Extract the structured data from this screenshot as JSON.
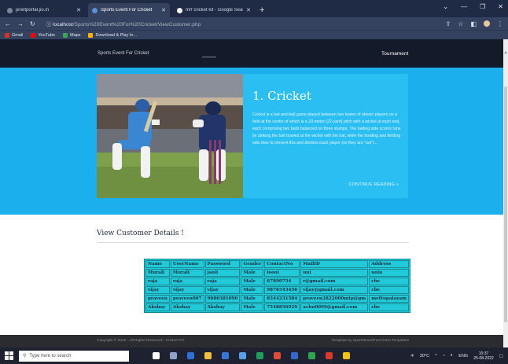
{
  "browser": {
    "tabs": [
      {
        "title": "jenetportal.jio.in",
        "color": "#7a869f",
        "active": false
      },
      {
        "title": "Sports Event For Cricket",
        "color": "#5b8fd9",
        "active": true
      },
      {
        "title": "mrf cricket kit - Google Search",
        "color": "#ffffff",
        "active": false
      }
    ],
    "url_host": "localhost",
    "url_path": "/Sports%20Event%20For%20Cricket/ViewCustomer.php",
    "bookmarks": [
      {
        "label": "Gmail",
        "color": "#d93025"
      },
      {
        "label": "YouTube",
        "color": "#ff0000"
      },
      {
        "label": "Maps",
        "color": "#34a853"
      },
      {
        "label": "Download & Play In...",
        "color": "#f4b400"
      }
    ]
  },
  "site": {
    "brand": "Sports Event For Cricket",
    "nav_tournament": "Tournament"
  },
  "hero": {
    "title": "1. Cricket",
    "body": "Cricket is a bat-and-ball game played between two teams of eleven players on a field at the centre of which is a 20-metre (22-yard) pitch with a wicket at each end, each comprising two bails balanced on three stumps. The batting side scores runs by striking the ball bowled at the wicket with the bat, while the bowling and fielding side tries to prevent this and dismiss each player (so they are \"out\")...",
    "more": "CONTINUE READING »"
  },
  "customers": {
    "heading": "View Customer Details !",
    "columns": [
      "Name",
      "UserName",
      "Password",
      "Gender",
      "ContactNo",
      "MailID",
      "Address"
    ],
    "rows": [
      [
        "Murali",
        "Murali",
        "jaoii",
        "Male",
        "ioooi",
        "uui",
        "uoiu"
      ],
      [
        "raja",
        "raja",
        "raja",
        "Male",
        "67890754",
        "r@gmail.com",
        "cbe"
      ],
      [
        "vijay",
        "vijay",
        "vijay",
        "Male",
        "9876543456",
        "vijay@gmail.com",
        "cbe"
      ],
      [
        "praveen",
        "praveen007",
        "9080381090",
        "Male",
        "8344231584",
        "praveen2822000mtp@gm",
        "mettupalayam"
      ],
      [
        "Akshay",
        "Akshay",
        "Akshay",
        "Male",
        "7548856929",
        "achu0099@gmail.com",
        "cbe"
      ]
    ]
  },
  "footer": {
    "left": "Copyright © 2022 - All Rights Reserved - Cricket KIT",
    "right": "Template by SportsEventForCricket Templates"
  },
  "taskbar": {
    "search_placeholder": "Type here to search",
    "apps": [
      "#ffffff",
      "#8fa3c8",
      "#2f6fd6",
      "#f0c23b",
      "#3a76d8",
      "#5aa0e8",
      "#1d9e5a",
      "#e24b3b",
      "#3b66c9",
      "#2ea44f",
      "#d9392b",
      "#f1c40f"
    ],
    "weather": "30°C",
    "lang": "ENG",
    "time": "10:37",
    "date": "25-08-2022"
  }
}
